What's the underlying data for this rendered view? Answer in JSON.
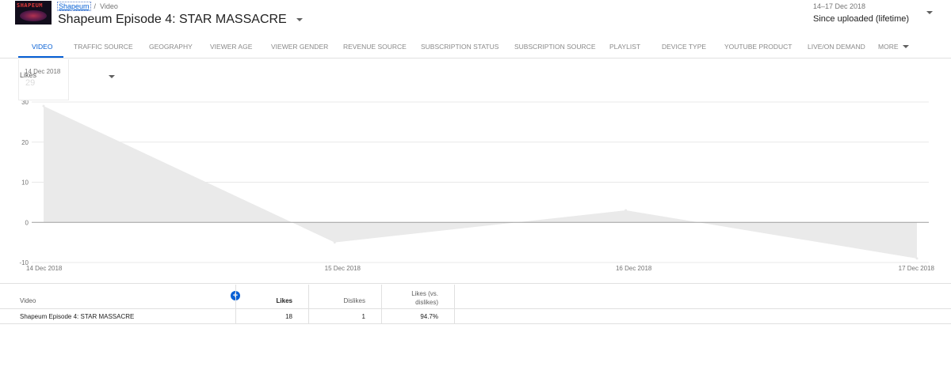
{
  "header": {
    "thumbnail_text": "SHAPEUM",
    "breadcrumb": {
      "channel": "Shapeum",
      "separator": "/",
      "section": "Video"
    },
    "video_title": "Shapeum Episode 4: STAR MASSACRE",
    "date_range": {
      "dates": "14–17 Dec 2018",
      "label": "Since uploaded (lifetime)"
    }
  },
  "tabs": [
    {
      "label": "Video",
      "active": true
    },
    {
      "label": "Traffic source"
    },
    {
      "label": "Geography"
    },
    {
      "label": "Viewer age"
    },
    {
      "label": "Viewer gender"
    },
    {
      "label": "Revenue source"
    },
    {
      "label": "Subscription status"
    },
    {
      "label": "Subscription source"
    },
    {
      "label": "Playlist"
    },
    {
      "label": "Device type"
    },
    {
      "label": "YouTube product"
    },
    {
      "label": "Live/on demand"
    },
    {
      "label": "More"
    }
  ],
  "metric_selector": {
    "label": "Likes"
  },
  "hover_card": {
    "date": "14 Dec 2018",
    "value": "29"
  },
  "colors": {
    "accent": "#065fd4",
    "area_fill": "#eaeaea",
    "grid": "#e8e8e8"
  },
  "chart_data": {
    "type": "area",
    "x": [
      "14 Dec 2018",
      "15 Dec 2018",
      "16 Dec 2018",
      "17 Dec 2018"
    ],
    "series": [
      {
        "values": [
          29,
          -5,
          3,
          -9
        ]
      }
    ],
    "y_ticks": [
      30,
      20,
      10,
      0,
      -10
    ],
    "ylim": [
      -10,
      30
    ],
    "grid": true
  },
  "table": {
    "columns": {
      "video": "Video",
      "likes": "Likes",
      "dislikes": "Dislikes",
      "ratio": "Likes (vs. dislikes)"
    },
    "add_metric_icon": "add-circle-icon",
    "rows": [
      {
        "video": "Shapeum Episode 4: STAR MASSACRE",
        "likes": "18",
        "dislikes": "1",
        "ratio": "94.7%"
      }
    ]
  }
}
